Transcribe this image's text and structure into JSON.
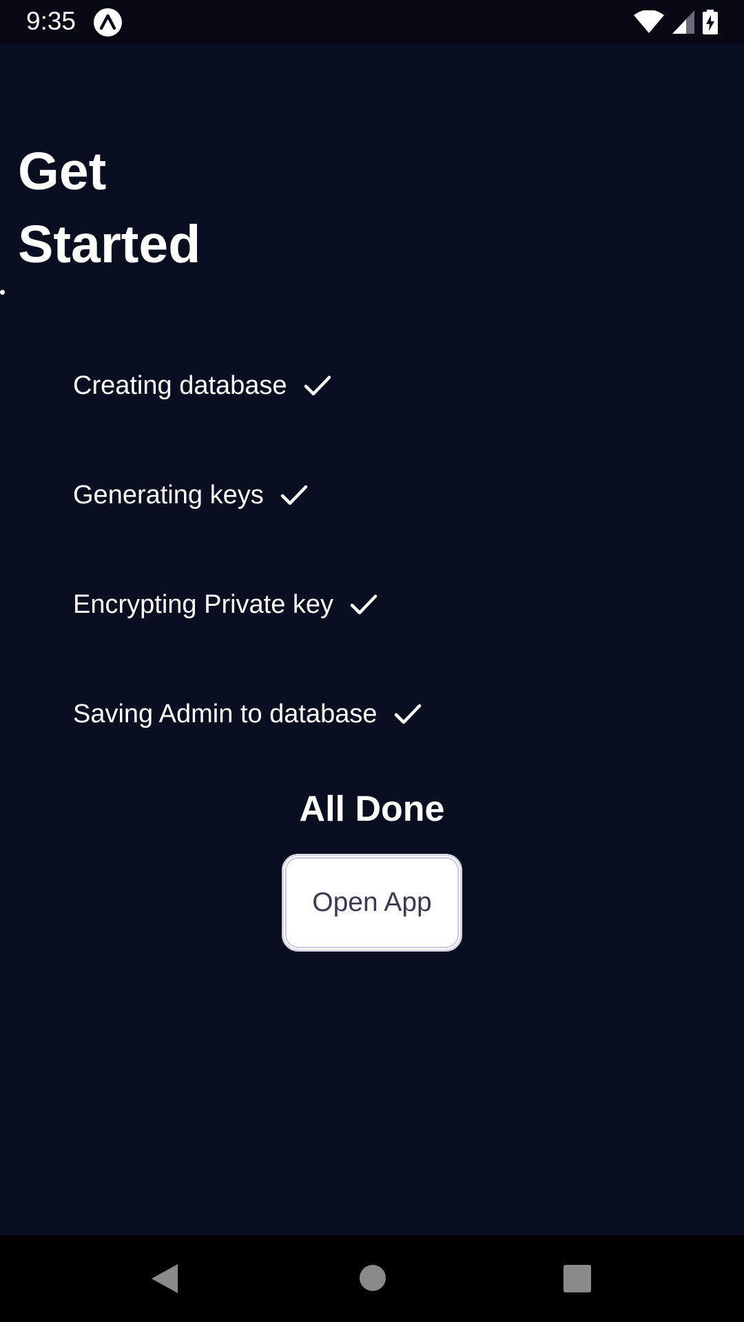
{
  "status_bar": {
    "time": "9:35",
    "icons": [
      "app-logo-icon",
      "wifi-icon",
      "cellular-signal-icon",
      "battery-charging-icon"
    ]
  },
  "page": {
    "title": "Get Started"
  },
  "steps": [
    {
      "label": "Creating database",
      "done": true
    },
    {
      "label": "Generating keys",
      "done": true
    },
    {
      "label": "Encrypting Private key",
      "done": true
    },
    {
      "label": "Saving Admin to database",
      "done": true
    }
  ],
  "completion": {
    "title": "All Done",
    "button_label": "Open App"
  },
  "nav_bar": {
    "buttons": [
      "back-icon",
      "home-icon",
      "recents-icon"
    ]
  },
  "colors": {
    "background": "#0a0e21",
    "status_bar": "#060913",
    "text": "#ffffff",
    "button_bg": "#ffffff",
    "button_text": "#3a3a52",
    "nav_bar": "#000000",
    "nav_icons": "#8a8a8a"
  }
}
